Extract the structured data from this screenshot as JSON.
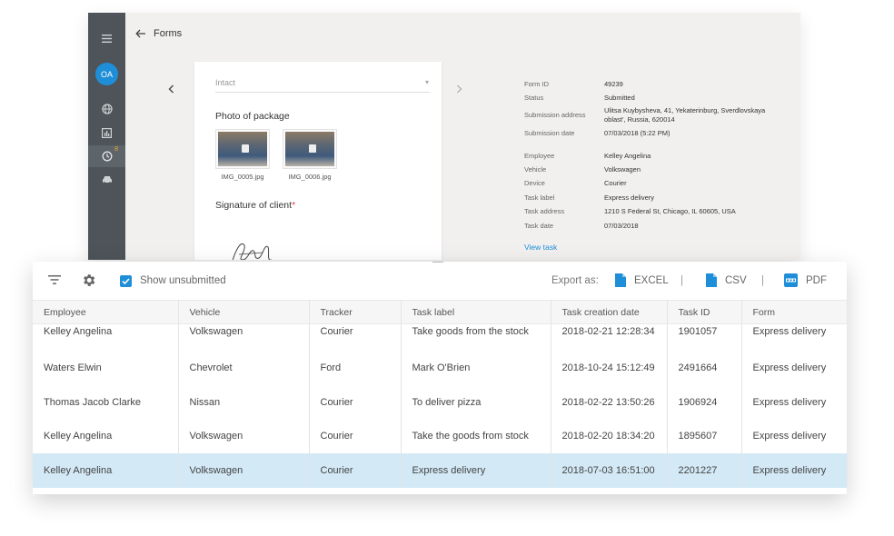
{
  "app": {
    "avatar_initials": "OA",
    "notification_badge": "8",
    "header_title": "Forms"
  },
  "form": {
    "select_value": "Intact",
    "photo_label": "Photo of package",
    "photos": [
      {
        "caption": "IMG_0005.jpg"
      },
      {
        "caption": "IMG_0006.jpg"
      }
    ],
    "signature_label": "Signature of client",
    "required_mark": "*"
  },
  "details": {
    "group1": [
      {
        "label": "Form ID",
        "value": "49239"
      },
      {
        "label": "Status",
        "value": "Submitted"
      },
      {
        "label": "Submission address",
        "value": "Ulitsa Kuybysheva, 41, Yekaterinburg, Sverdlovskaya oblast', Russia, 620014"
      },
      {
        "label": "Submission date",
        "value": "07/03/2018 (5:22 PM)"
      }
    ],
    "group2": [
      {
        "label": "Employee",
        "value": "Kelley Angelina"
      },
      {
        "label": "Vehicle",
        "value": "Volkswagen"
      },
      {
        "label": "Device",
        "value": "Courier"
      },
      {
        "label": "Task label",
        "value": "Express delivery"
      },
      {
        "label": "Task address",
        "value": "1210 S Federal St, Chicago, IL 60605, USA"
      },
      {
        "label": "Task date",
        "value": "07/03/2018"
      }
    ],
    "view_task_link": "View task"
  },
  "toolbar": {
    "show_unsubmitted_label": "Show unsubmitted",
    "show_unsubmitted_checked": true,
    "export_label": "Export as:",
    "export_excel": "EXCEL",
    "export_csv": "CSV",
    "export_pdf": "PDF",
    "separator": "|"
  },
  "table": {
    "columns": [
      "Employee",
      "Vehicle",
      "Tracker",
      "Task label",
      "Task creation date",
      "Task ID",
      "Form"
    ],
    "rows": [
      [
        "Kelley Angelina",
        "Volkswagen",
        "Courier",
        "Take goods from the stock",
        "2018-02-21 12:28:34",
        "1901057",
        "Express delivery"
      ],
      [
        "Waters Elwin",
        "Chevrolet",
        "Ford",
        "Mark O'Brien",
        "2018-10-24 15:12:49",
        "2491664",
        "Express delivery"
      ],
      [
        "Thomas Jacob Clarke",
        "Nissan",
        "Courier",
        "To deliver pizza",
        "2018-02-22 13:50:26",
        "1906924",
        "Express delivery"
      ],
      [
        "Kelley Angelina",
        "Volkswagen",
        "Courier",
        "Take the goods from stock",
        "2018-02-20 18:34:20",
        "1895607",
        "Express delivery"
      ],
      [
        "Kelley Angelina",
        "Volkswagen",
        "Courier",
        "Express delivery",
        "2018-07-03 16:51:00",
        "2201227",
        "Express delivery"
      ]
    ],
    "selected_row_index": 4
  },
  "colors": {
    "accent": "#1f8ed8",
    "sidebar": "#4e5459",
    "selected_row": "#d3e9f6",
    "required": "#e0424a"
  }
}
